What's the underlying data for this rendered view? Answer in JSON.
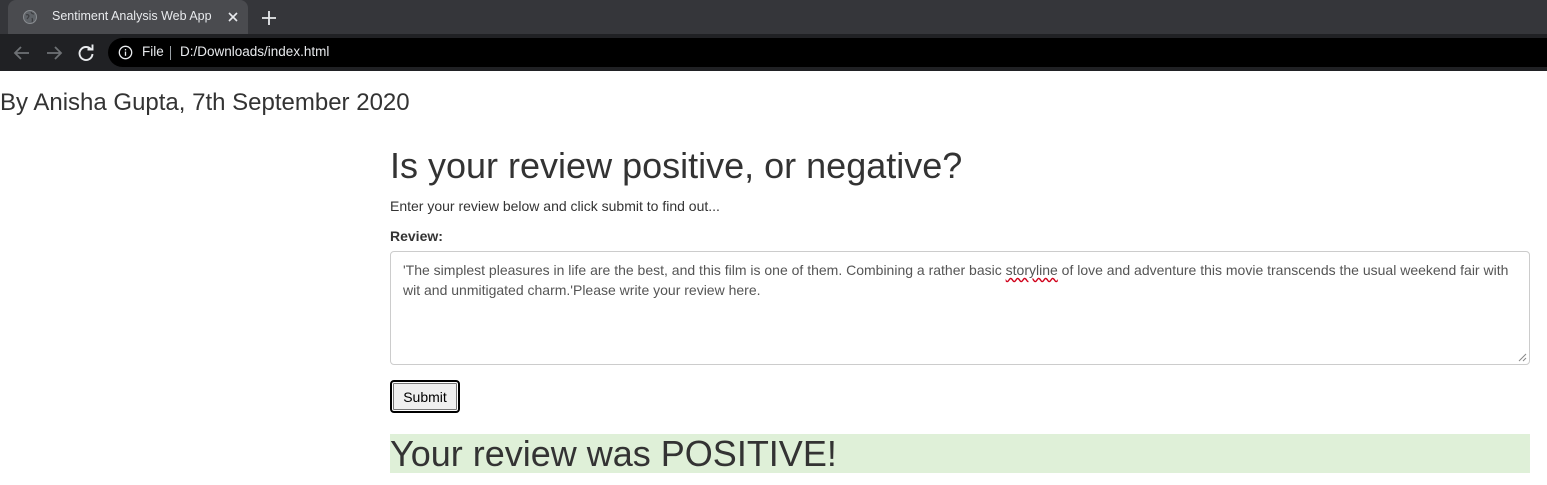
{
  "browser": {
    "tab_title": "Sentiment Analysis Web App",
    "omnibox_scheme": "File",
    "omnibox_url": "D:/Downloads/index.html"
  },
  "page": {
    "byline": "By Anisha Gupta, 7th September 2020",
    "heading": "Is your review positive, or negative?",
    "intro": "Enter your review below and click submit to find out...",
    "review_label": "Review:",
    "review_text_before": "'The simplest pleasures in life are the best, and this film is one of them. Combining a rather basic ",
    "review_text_misspelled": "storyline",
    "review_text_after": " of love and adventure this movie transcends the usual weekend fair with wit and unmitigated charm.'Please write your review here.",
    "submit_label": "Submit",
    "result": "Your review was POSITIVE!"
  },
  "colors": {
    "result_background": "#dff0d8",
    "text": "#333333"
  }
}
